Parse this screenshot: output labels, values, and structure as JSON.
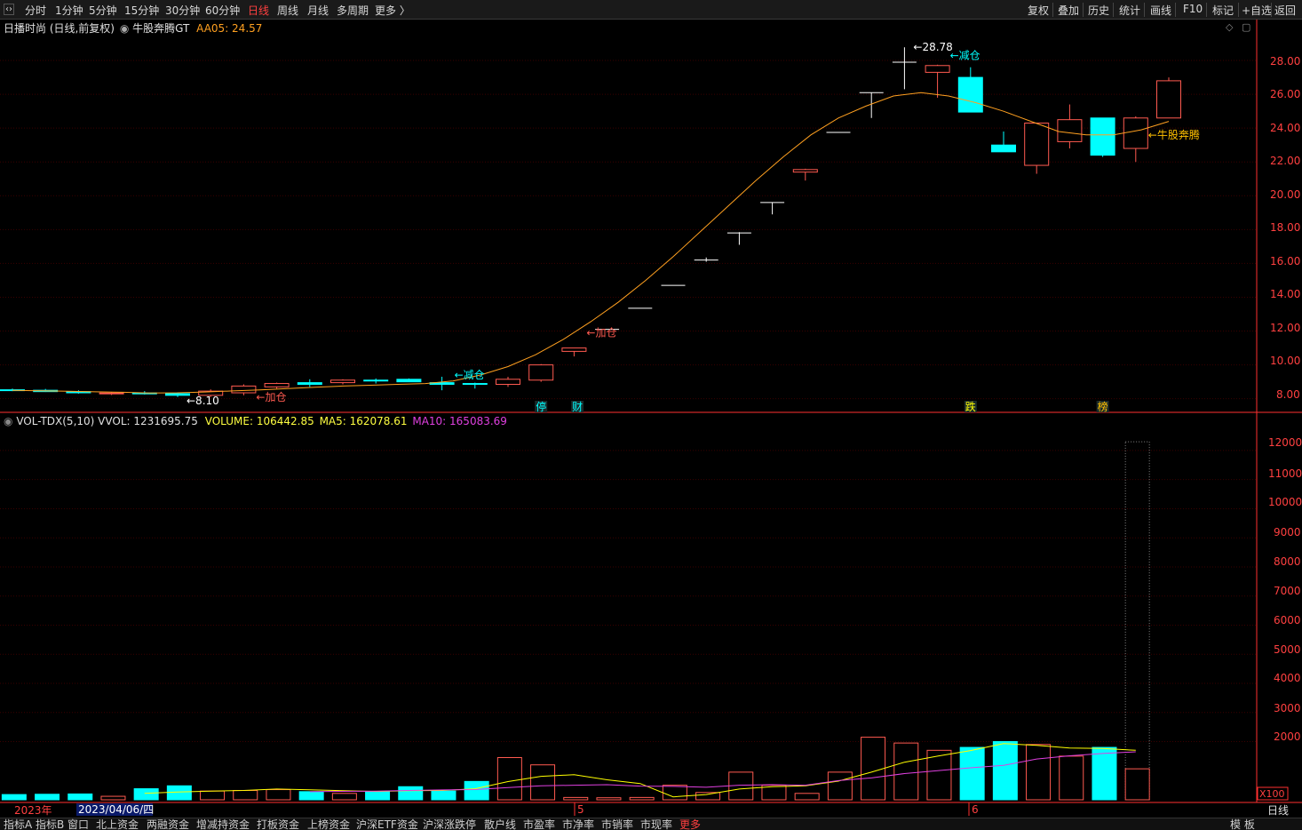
{
  "toolbar": {
    "left_icon": "chevron-left-right-icon",
    "periods": [
      "分时",
      "1分钟",
      "5分钟",
      "15分钟",
      "30分钟",
      "60分钟",
      "日线",
      "周线",
      "月线",
      "多周期",
      "更多 〉"
    ],
    "active_period": "日线",
    "right": [
      "复权",
      "叠加",
      "历史",
      "统计",
      "画线",
      "F10",
      "标记",
      "+自选",
      "返回"
    ]
  },
  "main_header": {
    "title": "日播时尚 (日线,前复权)",
    "indicator_name": "牛股奔腾GT",
    "aa05_label": "AA05: 24.57"
  },
  "volume_header": {
    "indicator": "VOL-TDX(5,10)",
    "vvol": "VVOL: 1231695.75",
    "volume": "VOLUME: 106442.85",
    "ma5": "MA5: 162078.61",
    "ma10": "MA10: 165083.69"
  },
  "colors": {
    "up": "#ff5a50",
    "down": "#00ffff",
    "ma_line": "#ffa020",
    "vol_ma5": "#ffff00",
    "vol_ma10": "#e040e0",
    "grid": "#3a0000",
    "axis": "#ff3030"
  },
  "price_axis_ticks": [
    "28.00",
    "26.00",
    "24.00",
    "22.00",
    "20.00",
    "18.00",
    "16.00",
    "14.00",
    "12.00",
    "10.00",
    "8.00"
  ],
  "volume_axis_ticks": [
    "12000",
    "11000",
    "10000",
    "9000",
    "8000",
    "7000",
    "6000",
    "5000",
    "4000",
    "3000",
    "2000"
  ],
  "volume_axis_unit": "X100",
  "date_labels": {
    "year": "2023年",
    "cursor_date": "2023/04/06/四",
    "m5": "5",
    "m6": "6"
  },
  "bottom_right_label": "日线",
  "bottom_tabs": [
    "指标A",
    "指标B",
    "窗口",
    "北上资金",
    "两融资金",
    "增减持资金",
    "打板资金",
    "上榜资金",
    "沪深ETF资金",
    "沪深涨跌停",
    "散户线",
    "市盈率",
    "市净率",
    "市销率",
    "市现率",
    "更多"
  ],
  "bottom_tabs_right": "模 板",
  "event_markers": [
    {
      "text": "停",
      "color": "#00ffff"
    },
    {
      "text": "财",
      "color": "#00ffff"
    },
    {
      "text": "跌",
      "color": "#ffff00"
    },
    {
      "text": "榜",
      "color": "#ffc000"
    }
  ],
  "chart_data": {
    "type": "candlestick",
    "price_range": [
      7.3,
      30.0
    ],
    "volume_range": [
      0,
      12700
    ],
    "high_label": "28.78",
    "low_label": "8.10",
    "annotations": [
      {
        "text": "←加仓",
        "bar": 7,
        "price": 8.1,
        "color": "#ff5a50"
      },
      {
        "text": "←减仓",
        "bar": 13,
        "price": 9.4,
        "color": "#00ffff"
      },
      {
        "text": "←加仓",
        "bar": 17,
        "price": 11.9,
        "color": "#ff5a50"
      },
      {
        "text": "←减仓",
        "bar": 28,
        "price": 28.3,
        "color": "#00ffff"
      },
      {
        "text": "←牛股奔腾",
        "bar": 34,
        "price": 23.6,
        "color": "#ffc000"
      }
    ],
    "candles": [
      {
        "o": 8.53,
        "h": 8.6,
        "l": 8.45,
        "c": 8.48
      },
      {
        "o": 8.5,
        "h": 8.58,
        "l": 8.4,
        "c": 8.42
      },
      {
        "o": 8.42,
        "h": 8.5,
        "l": 8.3,
        "c": 8.35
      },
      {
        "o": 8.3,
        "h": 8.4,
        "l": 8.22,
        "c": 8.34
      },
      {
        "o": 8.34,
        "h": 8.45,
        "l": 8.25,
        "c": 8.3
      },
      {
        "o": 8.3,
        "h": 8.38,
        "l": 8.1,
        "c": 8.2
      },
      {
        "o": 8.2,
        "h": 8.55,
        "l": 8.1,
        "c": 8.45
      },
      {
        "o": 8.35,
        "h": 8.85,
        "l": 8.2,
        "c": 8.75
      },
      {
        "o": 8.7,
        "h": 8.95,
        "l": 8.6,
        "c": 8.9
      },
      {
        "o": 8.95,
        "h": 9.15,
        "l": 8.7,
        "c": 8.85
      },
      {
        "o": 8.95,
        "h": 9.15,
        "l": 8.85,
        "c": 9.1
      },
      {
        "o": 9.1,
        "h": 9.2,
        "l": 8.9,
        "c": 9.05
      },
      {
        "o": 9.15,
        "h": 9.2,
        "l": 9.0,
        "c": 9.0
      },
      {
        "o": 8.95,
        "h": 9.3,
        "l": 8.5,
        "c": 8.85
      },
      {
        "o": 8.9,
        "h": 8.95,
        "l": 8.6,
        "c": 8.85
      },
      {
        "o": 8.85,
        "h": 9.3,
        "l": 8.7,
        "c": 9.15
      },
      {
        "o": 9.1,
        "h": 10.05,
        "l": 9.0,
        "c": 10.0
      },
      {
        "o": 10.8,
        "h": 11.0,
        "l": 10.5,
        "c": 11.0
      },
      {
        "o": 12.1,
        "h": 12.1,
        "l": 12.1,
        "c": 12.1
      },
      {
        "o": 13.35,
        "h": 13.35,
        "l": 13.35,
        "c": 13.35
      },
      {
        "o": 14.7,
        "h": 14.7,
        "l": 14.7,
        "c": 14.7
      },
      {
        "o": 16.2,
        "h": 16.35,
        "l": 16.1,
        "c": 16.2
      },
      {
        "o": 17.8,
        "h": 17.85,
        "l": 17.1,
        "c": 17.8
      },
      {
        "o": 19.6,
        "h": 19.6,
        "l": 18.9,
        "c": 19.6
      },
      {
        "o": 21.4,
        "h": 21.6,
        "l": 20.9,
        "c": 21.55
      },
      {
        "o": 23.75,
        "h": 23.75,
        "l": 23.75,
        "c": 23.75
      },
      {
        "o": 26.1,
        "h": 26.1,
        "l": 24.6,
        "c": 26.1
      },
      {
        "o": 27.9,
        "h": 28.78,
        "l": 26.3,
        "c": 27.9
      },
      {
        "o": 27.3,
        "h": 27.75,
        "l": 25.8,
        "c": 27.7
      },
      {
        "o": 27.0,
        "h": 27.6,
        "l": 24.95,
        "c": 24.95
      },
      {
        "o": 23.0,
        "h": 23.8,
        "l": 22.6,
        "c": 22.6
      },
      {
        "o": 21.8,
        "h": 24.3,
        "l": 21.3,
        "c": 24.3
      },
      {
        "o": 23.2,
        "h": 25.4,
        "l": 22.8,
        "c": 24.5
      },
      {
        "o": 24.6,
        "h": 24.6,
        "l": 22.3,
        "c": 22.4
      },
      {
        "o": 22.8,
        "h": 24.7,
        "l": 22.0,
        "c": 24.6
      },
      {
        "o": 24.6,
        "h": 27.0,
        "l": 24.6,
        "c": 26.8
      }
    ],
    "ma_line": [
      8.5,
      8.47,
      8.44,
      8.41,
      8.38,
      8.34,
      8.35,
      8.4,
      8.46,
      8.52,
      8.6,
      8.68,
      8.75,
      8.8,
      8.85,
      8.9,
      9.05,
      9.4,
      9.9,
      10.6,
      11.5,
      12.55,
      13.7,
      15.0,
      16.4,
      17.9,
      19.4,
      20.9,
      22.3,
      23.6,
      24.6,
      25.3,
      25.9,
      26.1,
      25.9,
      25.5,
      25.0,
      24.4,
      23.8,
      23.6,
      23.6,
      23.9,
      24.4
    ],
    "ma_line_start_bar": 0,
    "volumes": [
      180,
      190,
      200,
      120,
      380,
      480,
      300,
      320,
      350,
      280,
      220,
      280,
      450,
      300,
      630,
      1450,
      1200,
      80,
      70,
      80,
      500,
      250,
      950,
      500,
      220,
      950,
      2150,
      1950,
      1700,
      1800,
      2000,
      1900,
      1500,
      1800,
      12300
    ],
    "volume_cursor_bar": 34,
    "volume_last_shown": 1064,
    "vol_ma5": [
      null,
      null,
      null,
      null,
      220,
      270,
      300,
      320,
      370,
      346,
      310,
      286,
      310,
      320,
      380,
      626,
      806,
      860,
      686,
      560,
      100,
      180,
      370,
      450,
      480,
      640,
      950,
      1290,
      1500,
      1690,
      1930,
      1870,
      1780,
      1760,
      1700
    ],
    "vol_ma10": [
      null,
      null,
      null,
      null,
      null,
      null,
      null,
      null,
      null,
      278,
      290,
      300,
      320,
      340,
      350,
      420,
      480,
      500,
      520,
      470,
      460,
      430,
      500,
      520,
      500,
      660,
      750,
      900,
      1000,
      1100,
      1180,
      1400,
      1510,
      1590,
      1650
    ]
  }
}
